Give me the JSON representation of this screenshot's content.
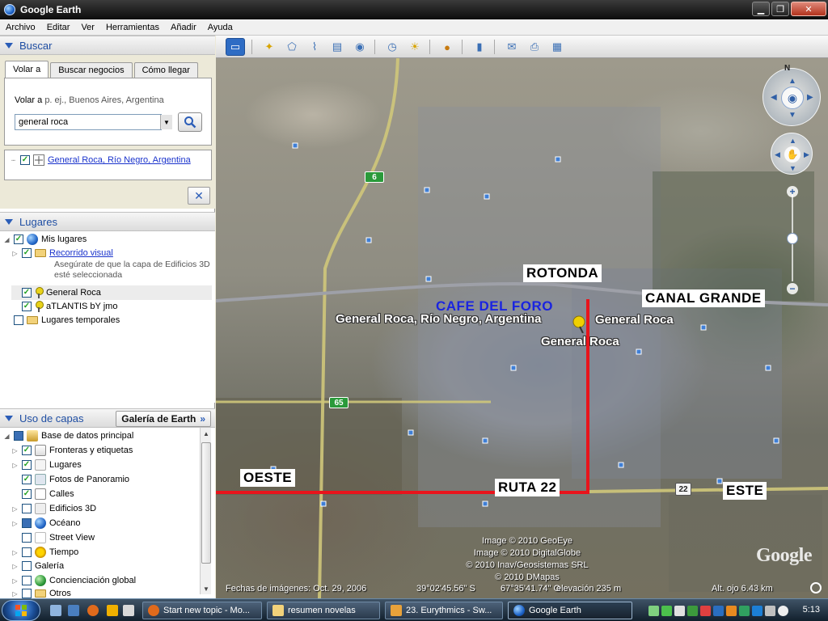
{
  "window": {
    "title": "Google Earth",
    "minimize": "▁",
    "maximize": "❐",
    "close": "✕"
  },
  "menu": [
    "Archivo",
    "Editar",
    "Ver",
    "Herramientas",
    "Añadir",
    "Ayuda"
  ],
  "search": {
    "header": "Buscar",
    "tabs": [
      "Volar a",
      "Buscar negocios",
      "Cómo llegar"
    ],
    "fly_label": "Volar a",
    "fly_hint": "p. ej., Buenos Aires, Argentina",
    "query": "general roca",
    "result": "General Roca, Río Negro, Argentina",
    "clear_icon": "✕"
  },
  "places": {
    "header": "Lugares",
    "items": [
      {
        "label": "Mis lugares"
      },
      {
        "label": "Recorrido visual",
        "note_line1": "Asegúrate de que la capa de Edificios 3D",
        "note_line2": "esté seleccionada"
      },
      {
        "label": "General Roca"
      },
      {
        "label": "aTLANTIS bY jmo"
      },
      {
        "label": "Lugares temporales"
      }
    ]
  },
  "layers": {
    "header": "Uso de capas",
    "gallery_button": "Galería de Earth",
    "gallery_icon": "»",
    "items": [
      {
        "label": "Base de datos principal"
      },
      {
        "label": "Fronteras y etiquetas"
      },
      {
        "label": "Lugares"
      },
      {
        "label": "Fotos de Panoramio"
      },
      {
        "label": "Calles"
      },
      {
        "label": "Edificios 3D"
      },
      {
        "label": "Océano"
      },
      {
        "label": "Street View"
      },
      {
        "label": "Tiempo"
      },
      {
        "label": "Galería"
      },
      {
        "label": "Concienciación global"
      },
      {
        "label": "Otros"
      }
    ]
  },
  "map": {
    "labels": {
      "rotonda": "ROTONDA",
      "canal_grande": "CANAL GRANDE",
      "cafe": "CAFE DEL FORO",
      "oeste": "OESTE",
      "ruta22": "RUTA 22",
      "este": "ESTE"
    },
    "places": {
      "full": "General Roca, Río Negro, Argentina",
      "short1": "General Roca",
      "short2": "General Roca"
    },
    "shields": {
      "r6": "6",
      "r65": "65",
      "r22": "22"
    },
    "credits": [
      "Image © 2010 GeoEye",
      "Image © 2010 DigitalGlobe",
      "© 2010 Inav/Geosistemas SRL",
      "© 2010 DMapas"
    ],
    "logo": "Google",
    "compass_north": "N",
    "zoom_in": "+",
    "zoom_out": "−",
    "status": {
      "dates": "Fechas de imágenes: Oct. 29, 2006",
      "lat": "39°02'45.56\" S",
      "lon": "67°35'41.74\" O",
      "elevation": "elevación  235 m",
      "eye_alt": "Alt. ojo    6.43 km"
    },
    "accent": "#e8141c"
  },
  "taskbar": {
    "tasks": [
      "Start new topic - Mo...",
      "resumen novelas",
      "23. Eurythmics - Sw...",
      "Google Earth"
    ],
    "clock": "5:13"
  }
}
